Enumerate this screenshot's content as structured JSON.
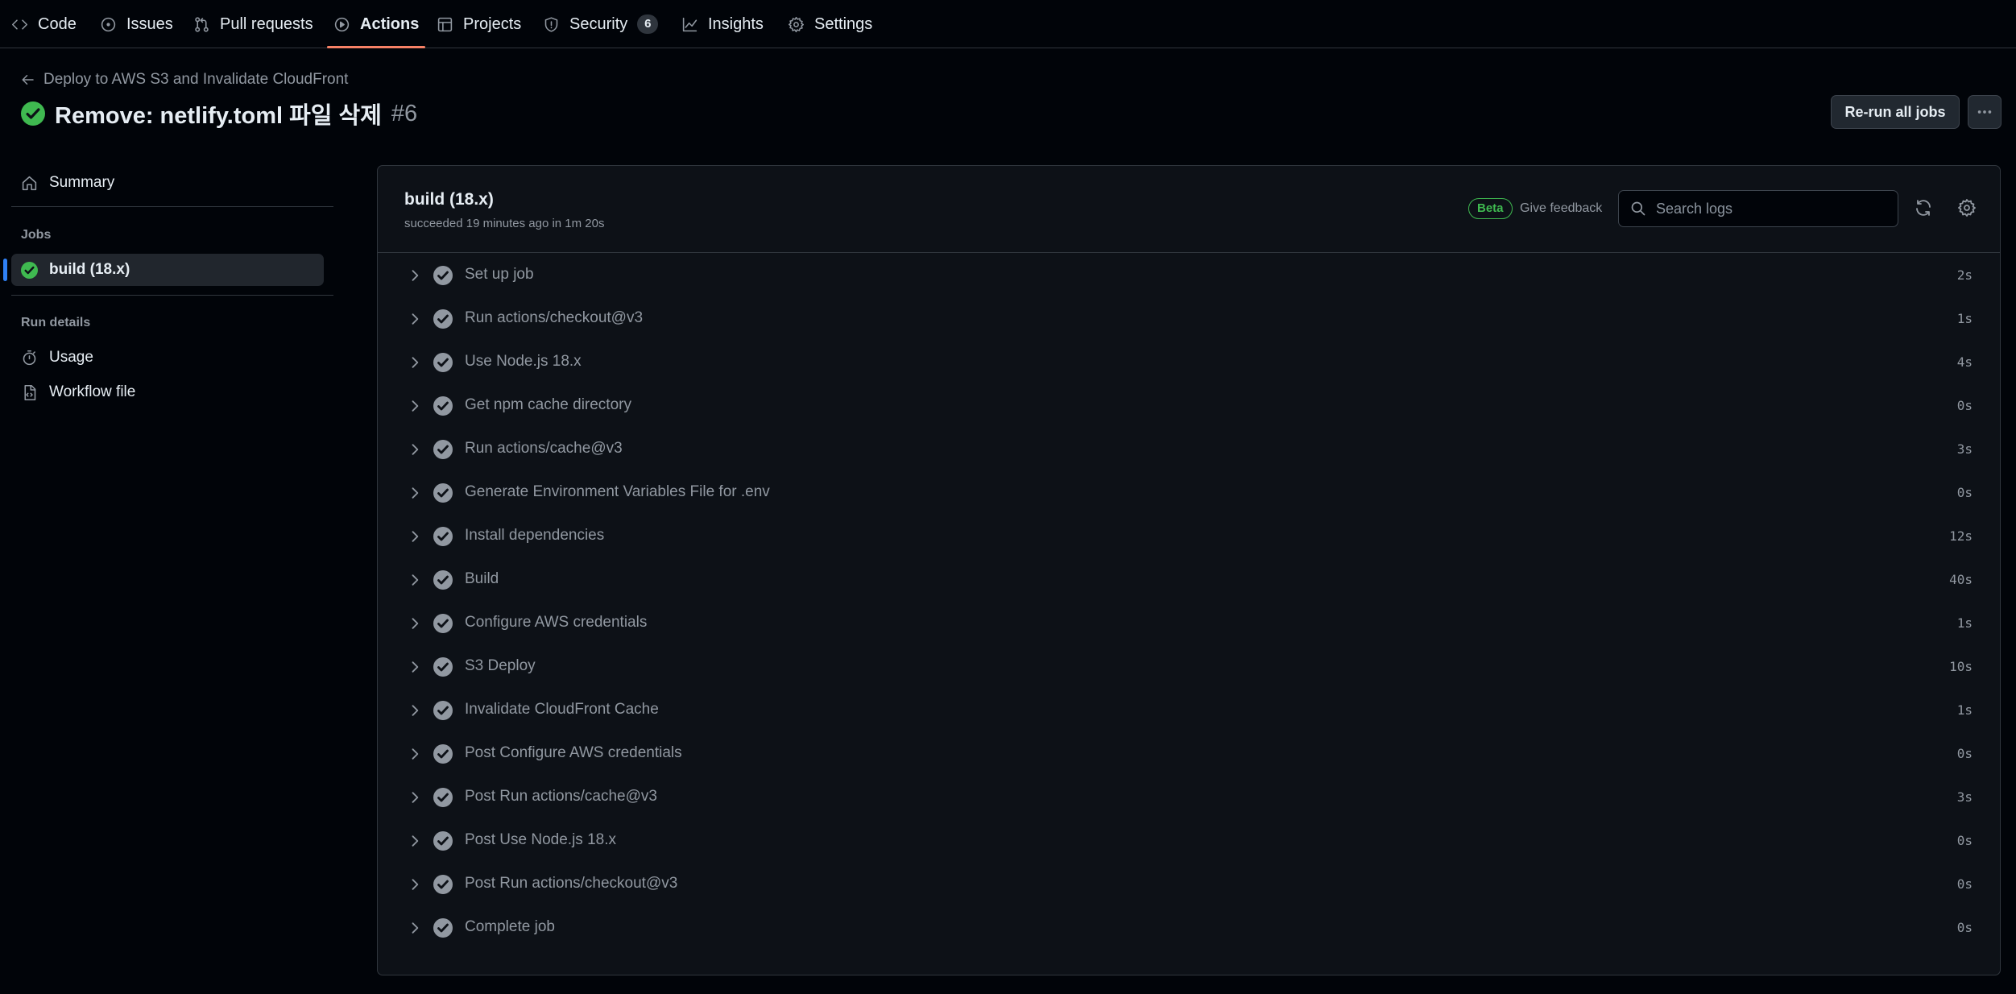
{
  "nav": {
    "tabs": [
      {
        "label": "Code",
        "icon": "code-icon"
      },
      {
        "label": "Issues",
        "icon": "issue-icon"
      },
      {
        "label": "Pull requests",
        "icon": "pull-request-icon"
      },
      {
        "label": "Actions",
        "icon": "play-icon",
        "active": true
      },
      {
        "label": "Projects",
        "icon": "table-icon"
      },
      {
        "label": "Security",
        "icon": "shield-icon",
        "count": "6"
      },
      {
        "label": "Insights",
        "icon": "graph-icon"
      },
      {
        "label": "Settings",
        "icon": "gear-icon"
      }
    ]
  },
  "header": {
    "workflow_name": "Deploy to AWS S3 and Invalidate CloudFront",
    "run_title": "Remove: netlify.toml 파일 삭제",
    "run_number": "#6",
    "rerun_label": "Re-run all jobs"
  },
  "sidebar": {
    "summary_label": "Summary",
    "jobs_heading": "Jobs",
    "job_label": "build (18.x)",
    "run_details_heading": "Run details",
    "usage_label": "Usage",
    "workflow_file_label": "Workflow file"
  },
  "job": {
    "title": "build (18.x)",
    "status_text": "succeeded 19 minutes ago in 1m 20s",
    "beta_label": "Beta",
    "feedback_label": "Give feedback",
    "search_placeholder": "Search logs",
    "steps": [
      {
        "name": "Set up job",
        "duration": "2s"
      },
      {
        "name": "Run actions/checkout@v3",
        "duration": "1s"
      },
      {
        "name": "Use Node.js 18.x",
        "duration": "4s"
      },
      {
        "name": "Get npm cache directory",
        "duration": "0s"
      },
      {
        "name": "Run actions/cache@v3",
        "duration": "3s"
      },
      {
        "name": "Generate Environment Variables File for .env",
        "duration": "0s"
      },
      {
        "name": "Install dependencies",
        "duration": "12s"
      },
      {
        "name": "Build",
        "duration": "40s"
      },
      {
        "name": "Configure AWS credentials",
        "duration": "1s"
      },
      {
        "name": "S3 Deploy",
        "duration": "10s"
      },
      {
        "name": "Invalidate CloudFront Cache",
        "duration": "1s"
      },
      {
        "name": "Post Configure AWS credentials",
        "duration": "0s"
      },
      {
        "name": "Post Run actions/cache@v3",
        "duration": "3s"
      },
      {
        "name": "Post Use Node.js 18.x",
        "duration": "0s"
      },
      {
        "name": "Post Run actions/checkout@v3",
        "duration": "0s"
      },
      {
        "name": "Complete job",
        "duration": "0s"
      }
    ]
  },
  "colors": {
    "success": "#3fb950",
    "accent_underline": "#f78166",
    "selected_marker": "#2f81f7",
    "step_check": "#9198a1"
  }
}
